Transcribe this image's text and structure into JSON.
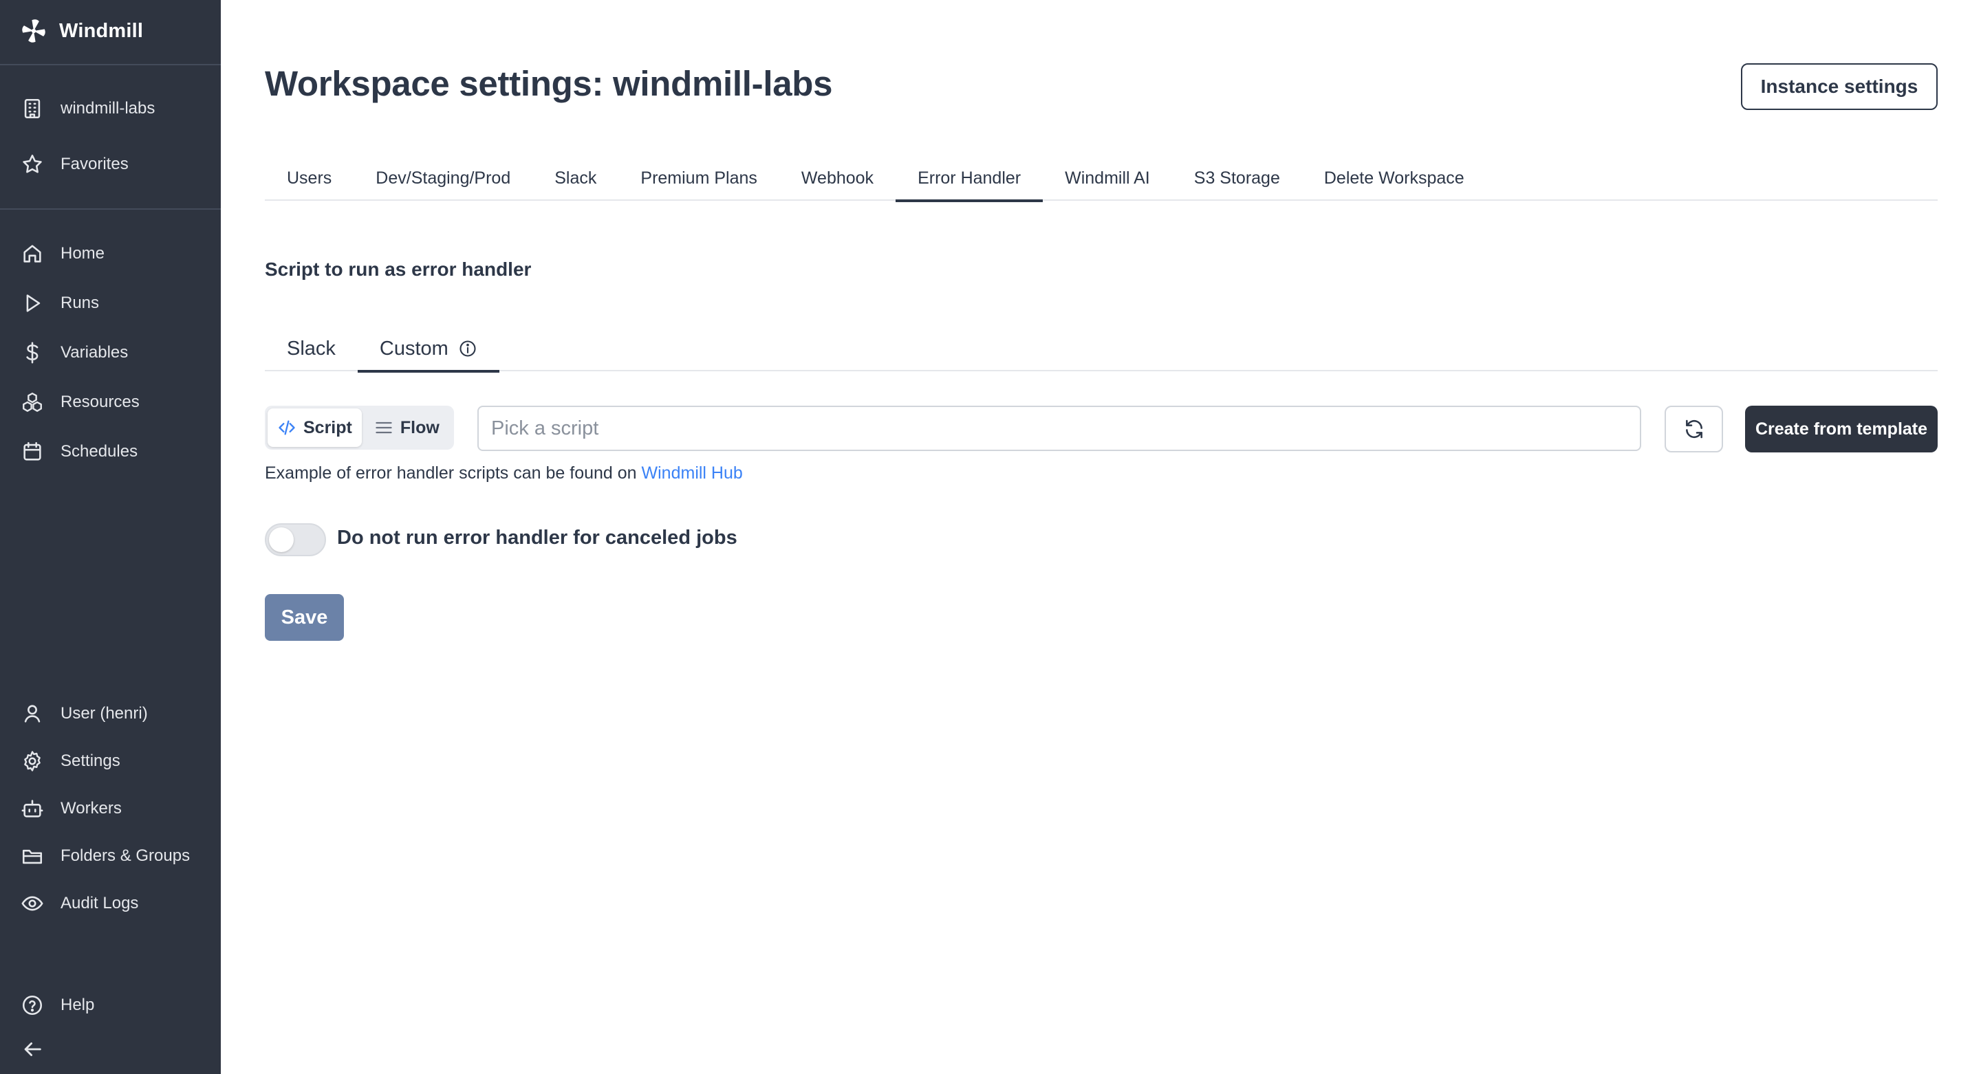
{
  "sidebar": {
    "brand": "Windmill",
    "workspace_items": [
      {
        "label": "windmill-labs",
        "icon": "building-icon"
      },
      {
        "label": "Favorites",
        "icon": "star-icon"
      }
    ],
    "main_items": [
      {
        "label": "Home",
        "icon": "home-icon"
      },
      {
        "label": "Runs",
        "icon": "play-icon"
      },
      {
        "label": "Variables",
        "icon": "dollar-icon"
      },
      {
        "label": "Resources",
        "icon": "boxes-icon"
      },
      {
        "label": "Schedules",
        "icon": "calendar-icon"
      }
    ],
    "bottom_items": [
      {
        "label": "User (henri)",
        "icon": "user-icon"
      },
      {
        "label": "Settings",
        "icon": "gear-icon"
      },
      {
        "label": "Workers",
        "icon": "bot-icon"
      },
      {
        "label": "Folders & Groups",
        "icon": "folder-icon"
      },
      {
        "label": "Audit Logs",
        "icon": "eye-icon"
      }
    ],
    "footer_items": [
      {
        "label": "Help",
        "icon": "help-circle-icon"
      },
      {
        "icon": "arrow-left-icon"
      }
    ]
  },
  "header": {
    "title": "Workspace settings: windmill-labs",
    "instance_settings_label": "Instance settings"
  },
  "tabs": [
    {
      "label": "Users",
      "active": false
    },
    {
      "label": "Dev/Staging/Prod",
      "active": false
    },
    {
      "label": "Slack",
      "active": false
    },
    {
      "label": "Premium Plans",
      "active": false
    },
    {
      "label": "Webhook",
      "active": false
    },
    {
      "label": "Error Handler",
      "active": true
    },
    {
      "label": "Windmill AI",
      "active": false
    },
    {
      "label": "S3 Storage",
      "active": false
    },
    {
      "label": "Delete Workspace",
      "active": false
    }
  ],
  "error_handler": {
    "section_title": "Script to run as error handler",
    "subtabs": [
      {
        "label": "Slack",
        "active": false
      },
      {
        "label": "Custom",
        "active": true,
        "icon": "info-icon"
      }
    ],
    "kind_toggle": [
      {
        "label": "Script",
        "active": true,
        "icon": "code-icon"
      },
      {
        "label": "Flow",
        "active": false,
        "icon": "list-icon"
      }
    ],
    "script_picker_placeholder": "Pick a script",
    "create_template_label": "Create from template",
    "hint_prefix": "Example of error handler scripts can be found on ",
    "hint_link": "Windmill Hub",
    "canceled_toggle_label": "Do not run error handler for canceled jobs",
    "canceled_toggle_on": false,
    "save_label": "Save"
  },
  "colors": {
    "sidebar_bg": "#2e3440",
    "text": "#2d3748",
    "link": "#3b82f6",
    "save_disabled": "#6b82a8",
    "primary_dark": "#2e3440"
  }
}
